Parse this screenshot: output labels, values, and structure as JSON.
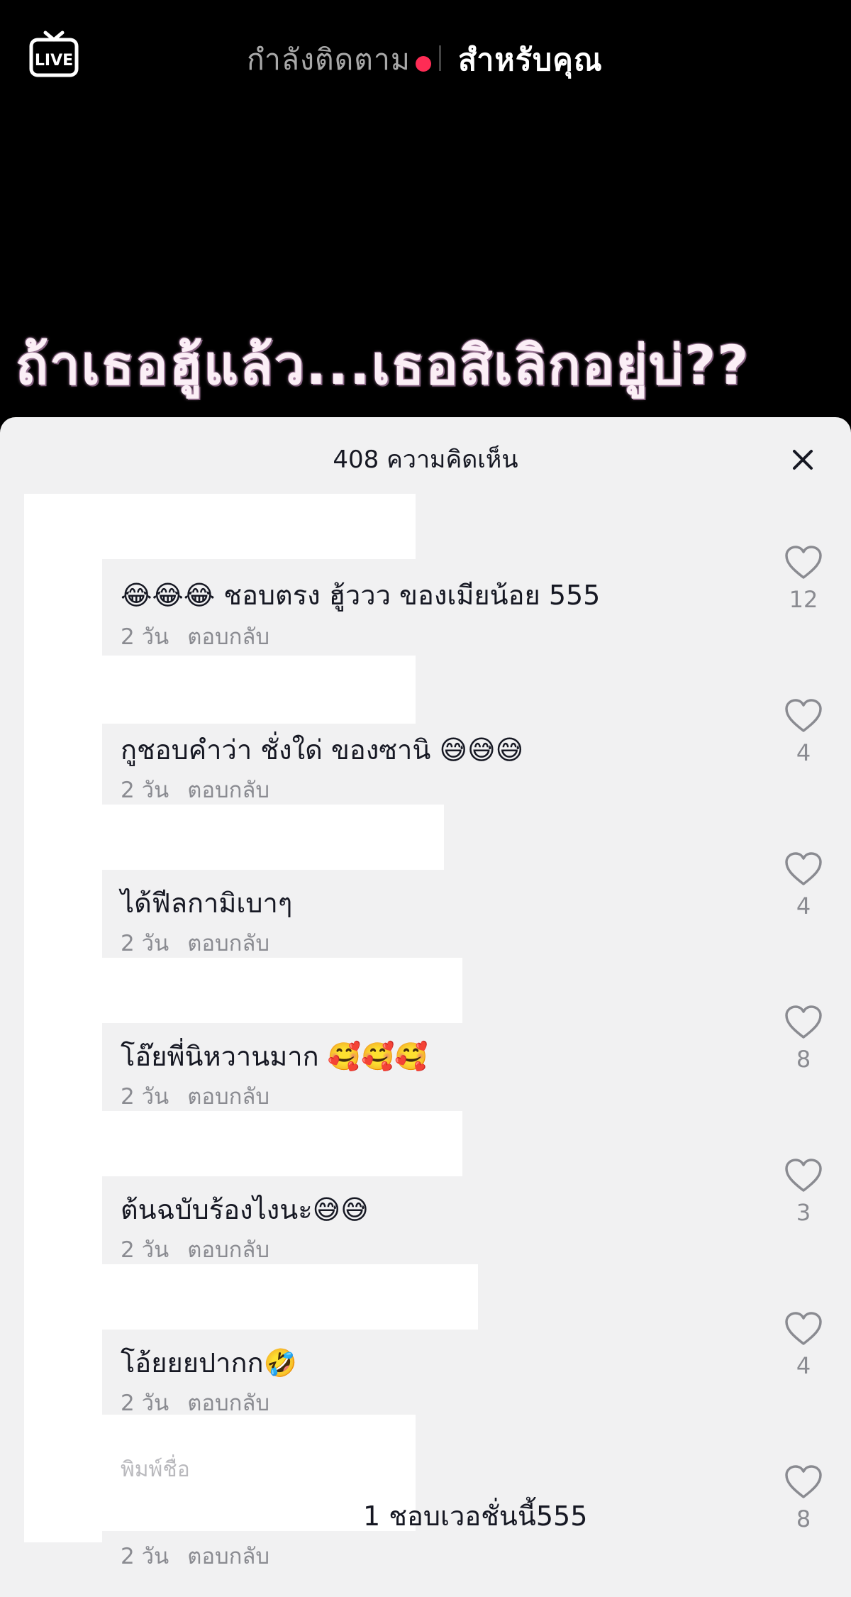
{
  "header": {
    "live_label": "LIVE",
    "tab_following": "กำลังติดตาม",
    "tab_for_you": "สำหรับคุณ"
  },
  "video": {
    "caption": "ถ้าเธอฮู้แล้ว...เธอสิเลิกอยู่บ่??"
  },
  "comments_sheet": {
    "title": "408 ความคิดเห็น",
    "comments": [
      {
        "text": "😂😂😂 ชอบตรง ฮู้ววว ของเมียน้อย 555",
        "age": "2 วัน",
        "reply": "ตอบกลับ",
        "likes": "12"
      },
      {
        "text": "กูชอบคำว่า ชั่งใด่ ของซานิ 😅😅😅",
        "age": "2 วัน",
        "reply": "ตอบกลับ",
        "likes": "4"
      },
      {
        "text": "ได้ฟีลกามิเบาๆ",
        "age": "2 วัน",
        "reply": "ตอบกลับ",
        "likes": "4"
      },
      {
        "text": "โอ๊ยพี่นิหวานมาก 🥰🥰🥰",
        "age": "2 วัน",
        "reply": "ตอบกลับ",
        "likes": "8"
      },
      {
        "text": "ต้นฉบับร้องไงนะ😅😅",
        "age": "2 วัน",
        "reply": "ตอบกลับ",
        "likes": "3"
      },
      {
        "text": "โอ้ยยยปากก🤣",
        "age": "2 วัน",
        "reply": "ตอบกลับ",
        "likes": "4"
      },
      {
        "text": "1 ชอบเวอชั่นนี้555",
        "age": "2 วัน",
        "reply": "ตอบกลับ",
        "likes": "8"
      }
    ],
    "partial_username": "พิมพ์ชื่อ"
  },
  "colors": {
    "accent_dot": "#fe2c55",
    "sheet_bg": "#f1f1f2",
    "muted_text": "#8a8b91"
  },
  "icons": {
    "live": "live-tv-icon",
    "close": "close-icon",
    "like": "heart-outline-icon"
  }
}
